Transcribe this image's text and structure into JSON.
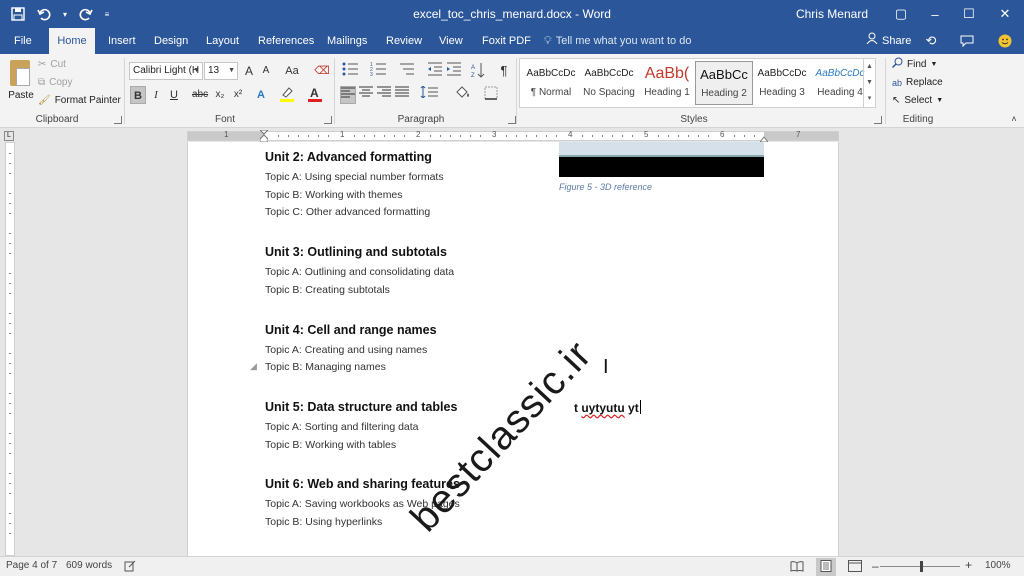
{
  "window": {
    "title": "excel_toc_chris_menard.docx  -  Word",
    "user": "Chris Menard",
    "controls": {
      "minimize": "–",
      "maximize": "☐",
      "close": "✕",
      "restore_ribbon": "▢"
    }
  },
  "qat": {
    "save_icon": "save-icon",
    "undo_icon": "undo-icon",
    "redo_icon": "redo-icon"
  },
  "tabs": [
    "File",
    "Home",
    "Insert",
    "Design",
    "Layout",
    "References",
    "Mailings",
    "Review",
    "View",
    "Foxit PDF"
  ],
  "active_tab": "Home",
  "tell_me": "Tell me what you want to do",
  "share": "Share",
  "ribbon": {
    "clipboard": {
      "paste": "Paste",
      "cut": "Cut",
      "copy": "Copy",
      "format_painter": "Format Painter",
      "label": "Clipboard"
    },
    "font": {
      "family": "Calibri Light (H",
      "size": "13",
      "grow": "A",
      "shrink": "A",
      "change_case": "Aa",
      "bold": "B",
      "italic": "I",
      "underline": "U",
      "strike": "abc",
      "subscript": "x₂",
      "superscript": "x²",
      "label": "Font"
    },
    "paragraph": {
      "label": "Paragraph",
      "pilcrow": "¶"
    },
    "styles": {
      "label": "Styles",
      "items": [
        {
          "preview": "AaBbCcDc",
          "name": "¶ Normal"
        },
        {
          "preview": "AaBbCcDc",
          "name": "No Spacing"
        },
        {
          "preview": "AaBb(",
          "name": "Heading 1"
        },
        {
          "preview": "AaBbCc",
          "name": "Heading 2"
        },
        {
          "preview": "AaBbCcDc",
          "name": "Heading 3"
        },
        {
          "preview": "AaBbCcDc",
          "name": "Heading 4"
        }
      ],
      "selected": "Heading 2"
    },
    "editing": {
      "find": "Find",
      "replace": "Replace",
      "select": "Select",
      "label": "Editing"
    }
  },
  "ruler": {
    "numbers": [
      "1",
      "1",
      "2",
      "3",
      "4",
      "5",
      "6",
      "7"
    ],
    "corner": "L"
  },
  "document": {
    "figure_caption": "Figure 5 - 3D reference",
    "units": [
      {
        "title": "Unit 2: Advanced formatting",
        "topics": [
          "Topic A: Using special number formats",
          "Topic B: Working with themes",
          "Topic C: Other advanced formatting"
        ]
      },
      {
        "title": "Unit 3: Outlining and subtotals",
        "topics": [
          "Topic A: Outlining and consolidating data",
          "Topic B: Creating subtotals"
        ]
      },
      {
        "title": "Unit 4: Cell and range names",
        "topics": [
          "Topic A: Creating and using names",
          "Topic B: Managing names"
        ]
      },
      {
        "title": "Unit 5: Data structure and tables",
        "topics": [
          "Topic A: Sorting and filtering data",
          "Topic B: Working with tables"
        ]
      },
      {
        "title": "Unit 6: Web and sharing features",
        "topics": [
          "Topic A: Saving workbooks as Web pages",
          "Topic B: Using hyperlinks"
        ]
      }
    ],
    "typed_text_plain": "t",
    "typed_text_squiggle": "uytyutu",
    "typed_text_end": "yt"
  },
  "watermark": "bestclassic.ir",
  "status": {
    "page": "Page 4 of 7",
    "words": "609 words",
    "zoom": "100%",
    "zoom_minus": "–",
    "zoom_plus": "+"
  }
}
